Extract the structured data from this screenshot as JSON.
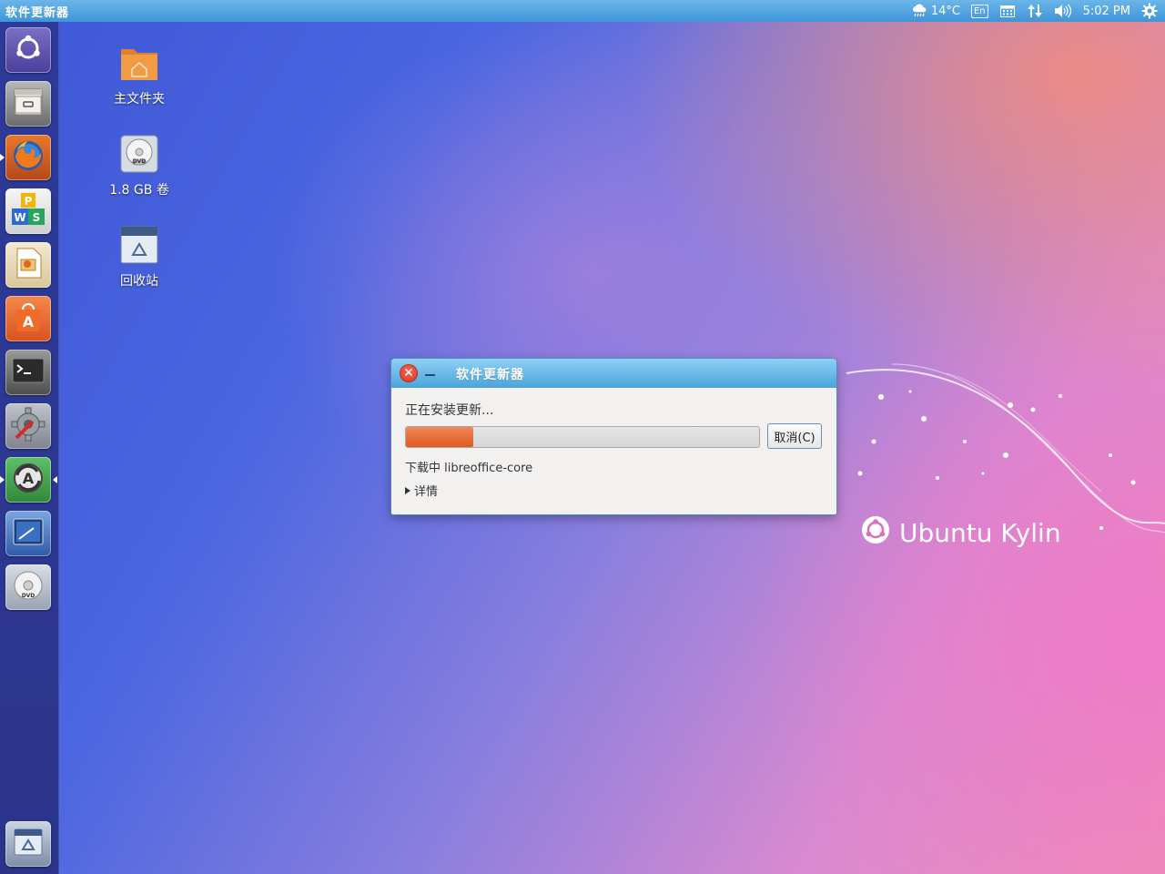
{
  "top_panel": {
    "app_title": "软件更新器",
    "weather_temp": "14°C",
    "keyboard_layout": "En",
    "clock": "5:02 PM"
  },
  "launcher": {
    "items": [
      {
        "name": "dash-home-icon"
      },
      {
        "name": "files-icon"
      },
      {
        "name": "firefox-icon"
      },
      {
        "name": "wps-office-icon"
      },
      {
        "name": "libreoffice-impress-icon"
      },
      {
        "name": "software-center-icon"
      },
      {
        "name": "terminal-icon"
      },
      {
        "name": "system-settings-icon"
      },
      {
        "name": "software-updater-icon"
      },
      {
        "name": "screenshot-tool-icon"
      },
      {
        "name": "dvd-drive-icon"
      }
    ],
    "trash_label": "trash-icon"
  },
  "desktop": {
    "icons": [
      {
        "label": "主文件夹"
      },
      {
        "label": "1.8 GB 卷"
      },
      {
        "label": "回收站"
      }
    ],
    "brand_text": "Ubuntu Kylin"
  },
  "dialog": {
    "title": "软件更新器",
    "status": "正在安装更新...",
    "progress_fraction": 0.19,
    "cancel_label": "取消(C)",
    "downloading": "下载中 libreoffice-core",
    "details_label": "详情"
  },
  "colors": {
    "panel": "#4aa4db",
    "launcher": "#2c3791",
    "progress": "#e0642a"
  }
}
